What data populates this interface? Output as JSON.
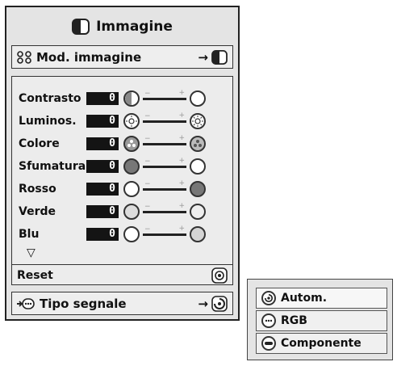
{
  "menu": {
    "title": "Immagine",
    "picture_mode": {
      "label": "Mod. immagine",
      "arrow": "→"
    },
    "adjustments": [
      {
        "label": "Contrasto",
        "value": "0"
      },
      {
        "label": "Luminos.",
        "value": "0"
      },
      {
        "label": "Colore",
        "value": "0"
      },
      {
        "label": "Sfumatura",
        "value": "0"
      },
      {
        "label": "Rosso",
        "value": "0"
      },
      {
        "label": "Verde",
        "value": "0"
      },
      {
        "label": "Blu",
        "value": "0"
      }
    ],
    "slider_minus": "−",
    "slider_plus": "+",
    "more_indicator": "▽",
    "reset": {
      "label": "Reset"
    },
    "signal_type": {
      "label": "Tipo segnale",
      "arrow": "→"
    }
  },
  "submenu": {
    "items": [
      {
        "label": "Autom.",
        "icon": "auto-icon"
      },
      {
        "label": "RGB",
        "icon": "rgb-icon"
      },
      {
        "label": "Componente",
        "icon": "component-icon"
      }
    ],
    "selected": "Autom."
  }
}
